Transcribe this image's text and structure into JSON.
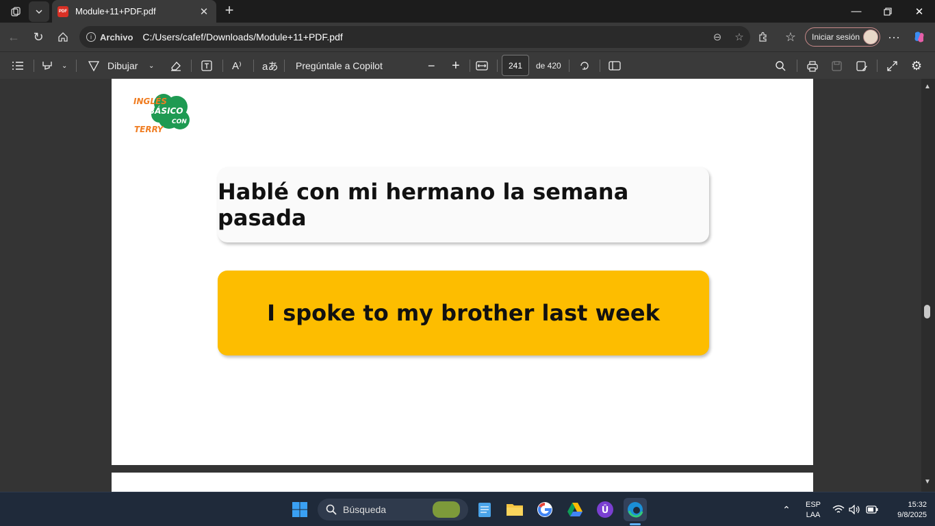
{
  "browser": {
    "tab_title": "Module+11+PDF.pdf",
    "tab_icon_label": "PDF",
    "address_scheme": "Archivo",
    "address_url": "C:/Users/cafef/Downloads/Module+11+PDF.pdf",
    "signin_label": "Iniciar sesión"
  },
  "pdf_toolbar": {
    "draw_label": "Dibujar",
    "copilot_label": "Pregúntale a Copilot",
    "current_page": "241",
    "page_total": "de 420"
  },
  "document": {
    "logo_text": {
      "top": "INGLÉS",
      "mid": "BÁSICO",
      "con": "CON",
      "bottom": "TERRY"
    },
    "spanish_sentence": "Hablé con mi hermano la semana pasada",
    "english_sentence": "I spoke to my brother last week",
    "colors": {
      "accent": "#fdbd00",
      "logo_green": "#1e9a52",
      "logo_orange": "#f07d22"
    }
  },
  "taskbar": {
    "search_label": "Búsqueda",
    "lang_top": "ESP",
    "lang_bottom": "LAA",
    "time": "15:32",
    "date": "9/8/2025"
  }
}
